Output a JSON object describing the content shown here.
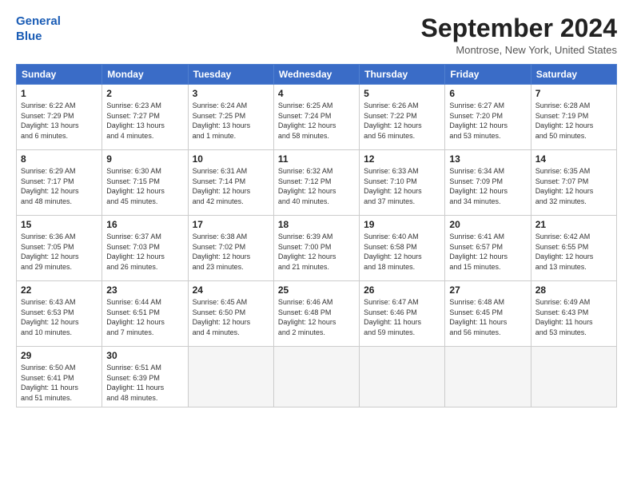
{
  "header": {
    "logo_line1": "General",
    "logo_line2": "Blue",
    "month_title": "September 2024",
    "location": "Montrose, New York, United States"
  },
  "weekdays": [
    "Sunday",
    "Monday",
    "Tuesday",
    "Wednesday",
    "Thursday",
    "Friday",
    "Saturday"
  ],
  "weeks": [
    [
      {
        "day": "1",
        "info": "Sunrise: 6:22 AM\nSunset: 7:29 PM\nDaylight: 13 hours\nand 6 minutes."
      },
      {
        "day": "2",
        "info": "Sunrise: 6:23 AM\nSunset: 7:27 PM\nDaylight: 13 hours\nand 4 minutes."
      },
      {
        "day": "3",
        "info": "Sunrise: 6:24 AM\nSunset: 7:25 PM\nDaylight: 13 hours\nand 1 minute."
      },
      {
        "day": "4",
        "info": "Sunrise: 6:25 AM\nSunset: 7:24 PM\nDaylight: 12 hours\nand 58 minutes."
      },
      {
        "day": "5",
        "info": "Sunrise: 6:26 AM\nSunset: 7:22 PM\nDaylight: 12 hours\nand 56 minutes."
      },
      {
        "day": "6",
        "info": "Sunrise: 6:27 AM\nSunset: 7:20 PM\nDaylight: 12 hours\nand 53 minutes."
      },
      {
        "day": "7",
        "info": "Sunrise: 6:28 AM\nSunset: 7:19 PM\nDaylight: 12 hours\nand 50 minutes."
      }
    ],
    [
      {
        "day": "8",
        "info": "Sunrise: 6:29 AM\nSunset: 7:17 PM\nDaylight: 12 hours\nand 48 minutes."
      },
      {
        "day": "9",
        "info": "Sunrise: 6:30 AM\nSunset: 7:15 PM\nDaylight: 12 hours\nand 45 minutes."
      },
      {
        "day": "10",
        "info": "Sunrise: 6:31 AM\nSunset: 7:14 PM\nDaylight: 12 hours\nand 42 minutes."
      },
      {
        "day": "11",
        "info": "Sunrise: 6:32 AM\nSunset: 7:12 PM\nDaylight: 12 hours\nand 40 minutes."
      },
      {
        "day": "12",
        "info": "Sunrise: 6:33 AM\nSunset: 7:10 PM\nDaylight: 12 hours\nand 37 minutes."
      },
      {
        "day": "13",
        "info": "Sunrise: 6:34 AM\nSunset: 7:09 PM\nDaylight: 12 hours\nand 34 minutes."
      },
      {
        "day": "14",
        "info": "Sunrise: 6:35 AM\nSunset: 7:07 PM\nDaylight: 12 hours\nand 32 minutes."
      }
    ],
    [
      {
        "day": "15",
        "info": "Sunrise: 6:36 AM\nSunset: 7:05 PM\nDaylight: 12 hours\nand 29 minutes."
      },
      {
        "day": "16",
        "info": "Sunrise: 6:37 AM\nSunset: 7:03 PM\nDaylight: 12 hours\nand 26 minutes."
      },
      {
        "day": "17",
        "info": "Sunrise: 6:38 AM\nSunset: 7:02 PM\nDaylight: 12 hours\nand 23 minutes."
      },
      {
        "day": "18",
        "info": "Sunrise: 6:39 AM\nSunset: 7:00 PM\nDaylight: 12 hours\nand 21 minutes."
      },
      {
        "day": "19",
        "info": "Sunrise: 6:40 AM\nSunset: 6:58 PM\nDaylight: 12 hours\nand 18 minutes."
      },
      {
        "day": "20",
        "info": "Sunrise: 6:41 AM\nSunset: 6:57 PM\nDaylight: 12 hours\nand 15 minutes."
      },
      {
        "day": "21",
        "info": "Sunrise: 6:42 AM\nSunset: 6:55 PM\nDaylight: 12 hours\nand 13 minutes."
      }
    ],
    [
      {
        "day": "22",
        "info": "Sunrise: 6:43 AM\nSunset: 6:53 PM\nDaylight: 12 hours\nand 10 minutes."
      },
      {
        "day": "23",
        "info": "Sunrise: 6:44 AM\nSunset: 6:51 PM\nDaylight: 12 hours\nand 7 minutes."
      },
      {
        "day": "24",
        "info": "Sunrise: 6:45 AM\nSunset: 6:50 PM\nDaylight: 12 hours\nand 4 minutes."
      },
      {
        "day": "25",
        "info": "Sunrise: 6:46 AM\nSunset: 6:48 PM\nDaylight: 12 hours\nand 2 minutes."
      },
      {
        "day": "26",
        "info": "Sunrise: 6:47 AM\nSunset: 6:46 PM\nDaylight: 11 hours\nand 59 minutes."
      },
      {
        "day": "27",
        "info": "Sunrise: 6:48 AM\nSunset: 6:45 PM\nDaylight: 11 hours\nand 56 minutes."
      },
      {
        "day": "28",
        "info": "Sunrise: 6:49 AM\nSunset: 6:43 PM\nDaylight: 11 hours\nand 53 minutes."
      }
    ],
    [
      {
        "day": "29",
        "info": "Sunrise: 6:50 AM\nSunset: 6:41 PM\nDaylight: 11 hours\nand 51 minutes."
      },
      {
        "day": "30",
        "info": "Sunrise: 6:51 AM\nSunset: 6:39 PM\nDaylight: 11 hours\nand 48 minutes."
      },
      {
        "day": "",
        "info": ""
      },
      {
        "day": "",
        "info": ""
      },
      {
        "day": "",
        "info": ""
      },
      {
        "day": "",
        "info": ""
      },
      {
        "day": "",
        "info": ""
      }
    ]
  ]
}
